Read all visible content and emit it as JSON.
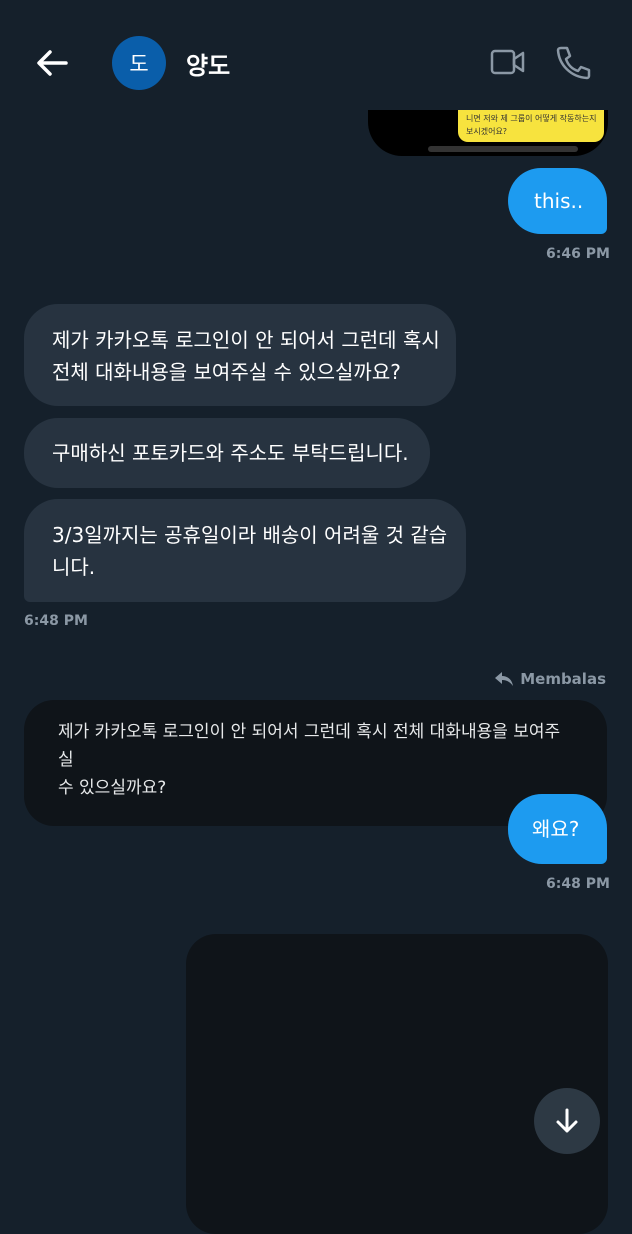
{
  "header": {
    "avatar_initial": "도",
    "contact_name": "양도",
    "icons": [
      "back-arrow-icon",
      "video-call-icon",
      "phone-call-icon"
    ]
  },
  "media_top_caption": "니면 저와 제 그룹이 어떻게 작동하는지 보시겠어요?",
  "messages": {
    "out1": {
      "text": "this..",
      "time": "6:46 PM"
    },
    "in1": {
      "text_line1": "제가 카카오톡 로그인이 안 되어서 그런데 혹시",
      "text_line2": "전체 대화내용을 보여주실 수 있으실까요?"
    },
    "in2": {
      "text": "구매하신 포토카드와 주소도 부탁드립니다."
    },
    "in3": {
      "text_line1": "3/3일까지는 공휴일이라 배송이 어려울 것 같습",
      "text_line2": "니다."
    },
    "in_time": "6:48 PM",
    "reply_label": "Membalas",
    "quoted": {
      "line1": "제가 카카오톡 로그인이 안 되어서 그런데 혹시 전체 대화내용을 보여주실",
      "line2": "수 있으실까요?"
    },
    "out2": {
      "text": "왜요?",
      "time": "6:48 PM"
    }
  },
  "colors": {
    "background": "#15202b",
    "outgoing_bubble": "#1d9bf0",
    "incoming_bubble": "#273340",
    "timestamp": "#8b98a5"
  }
}
